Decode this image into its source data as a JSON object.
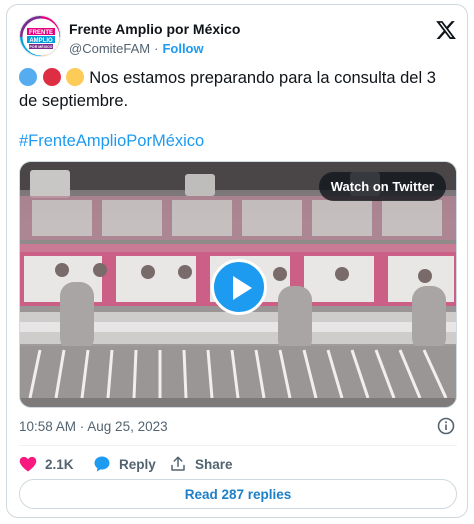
{
  "account": {
    "display_name": "Frente Amplio por México",
    "handle": "@ComiteFAM",
    "separator": "·",
    "follow_label": "Follow",
    "avatar_text": [
      "FRENTE",
      "AMPLIO",
      "POR MÉXICO"
    ]
  },
  "tweet": {
    "emoji_colors": [
      "#55acee",
      "#dd2e44",
      "#fdcb58"
    ],
    "text": "Nos estamos preparando para la consulta del 3 de septiembre.",
    "hashtag": "#FrenteAmplioPorMéxico",
    "timestamp": "10:58 AM · Aug 25, 2023"
  },
  "media": {
    "watch_label": "Watch on Twitter"
  },
  "actions": {
    "like_count": "2.1K",
    "reply_label": "Reply",
    "share_label": "Share"
  },
  "replies": {
    "label": "Read 287 replies"
  },
  "colors": {
    "accent": "#1d9bf0",
    "like": "#f91880",
    "text": "#0f1419",
    "muted": "#536471"
  }
}
